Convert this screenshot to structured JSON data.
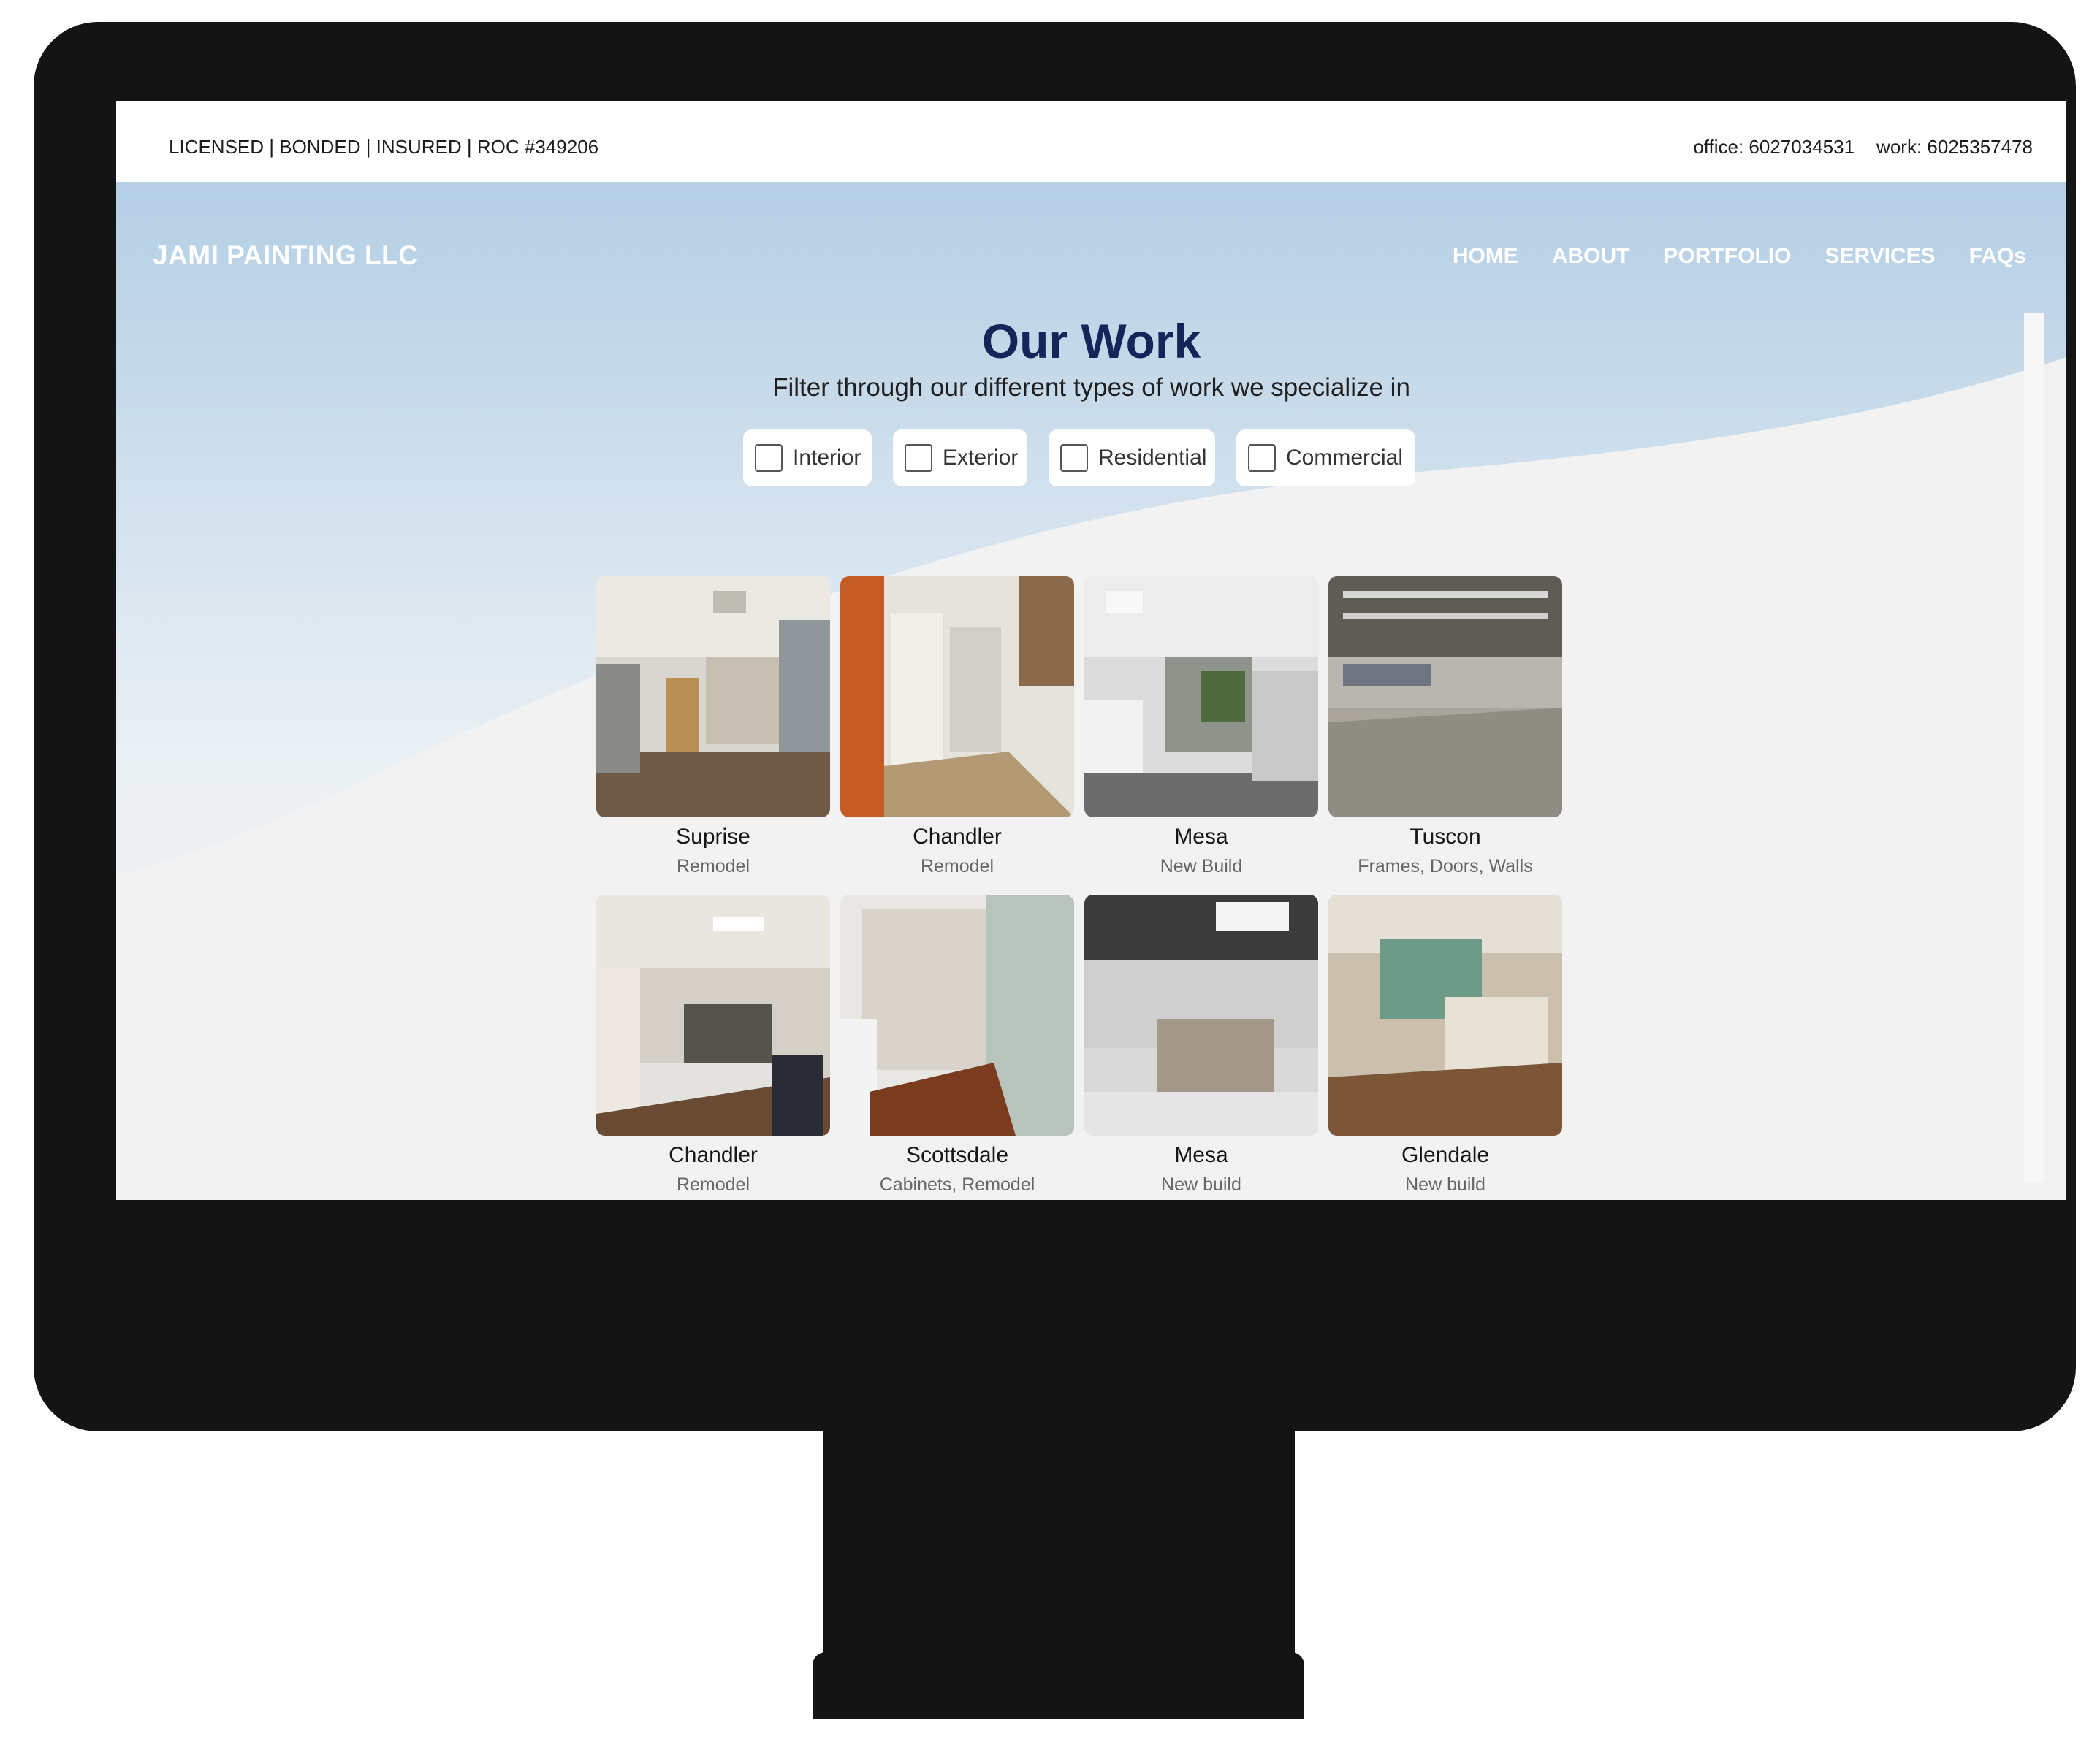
{
  "topbar": {
    "license_text": "LICENSED | BONDED | INSURED | ROC #349206",
    "office_phone": "office: 6027034531",
    "work_phone": "work: 6025357478"
  },
  "header": {
    "brand": "JAMI PAINTING LLC",
    "nav": [
      "HOME",
      "ABOUT",
      "PORTFOLIO",
      "SERVICES",
      "FAQs"
    ]
  },
  "section": {
    "title": "Our Work",
    "subtitle": "Filter through our different types of work we specialize in"
  },
  "filters": [
    {
      "label": "Interior",
      "checked": false
    },
    {
      "label": "Exterior",
      "checked": false
    },
    {
      "label": "Residential",
      "checked": false
    },
    {
      "label": "Commercial",
      "checked": false
    }
  ],
  "projects": [
    {
      "city": "Suprise",
      "description": "Remodel"
    },
    {
      "city": "Chandler",
      "description": "Remodel"
    },
    {
      "city": "Mesa",
      "description": "New Build"
    },
    {
      "city": "Tuscon",
      "description": "Frames, Doors, Walls"
    },
    {
      "city": "Chandler",
      "description": "Remodel"
    },
    {
      "city": "Scottsdale",
      "description": "Cabinets, Remodel"
    },
    {
      "city": "Mesa",
      "description": "New build"
    },
    {
      "city": "Glendale",
      "description": "New build"
    }
  ],
  "colors": {
    "title": "#15255a",
    "nav_text": "#ffffff",
    "monitor_frame": "#141414"
  }
}
